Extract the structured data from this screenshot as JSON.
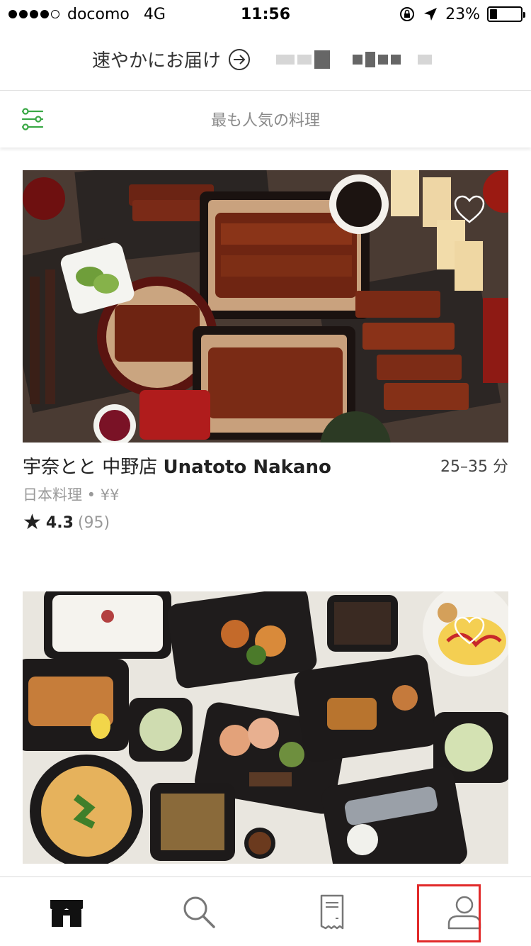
{
  "status_bar": {
    "carrier": "docomo",
    "network": "4G",
    "time": "11:56",
    "battery": "23%",
    "battery_level": 0.23
  },
  "header": {
    "delivery_label": "速やかにお届け",
    "arrow_icon": "arrow-right-circle-icon"
  },
  "filter": {
    "icon": "filter-sliders-icon",
    "title": "最も人気の料理",
    "accent_color": "#3aa845"
  },
  "restaurants": [
    {
      "name_ja": "宇奈とと 中野店",
      "name_en": "Unatoto Nakano",
      "time": "25–35 分",
      "category": "日本料理 • ¥¥",
      "rating": "4.3",
      "rating_count": "(95)"
    },
    {
      "name_ja": "",
      "name_en": "",
      "time": "",
      "category": "",
      "rating": "",
      "rating_count": ""
    }
  ],
  "tabs": [
    {
      "icon": "store-icon",
      "active": true
    },
    {
      "icon": "search-icon",
      "active": false
    },
    {
      "icon": "receipt-icon",
      "active": false
    },
    {
      "icon": "account-icon",
      "active": false
    }
  ],
  "colors": {
    "highlight": "#e12a2a",
    "accent": "#3aa845"
  }
}
